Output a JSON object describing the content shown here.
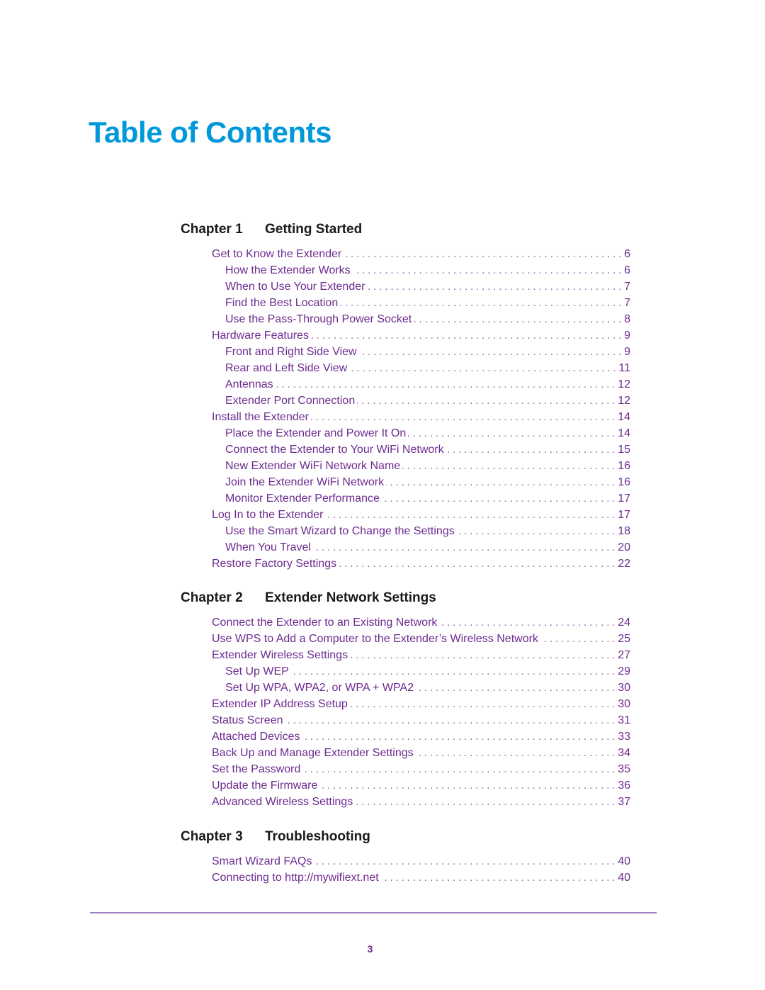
{
  "title": "Table of Contents",
  "colors": {
    "title": "#0098da",
    "entries": "#6d2b8f",
    "rule": "#a07cc3",
    "chapter": "#1a1a1a"
  },
  "chapters": [
    {
      "number": "Chapter 1",
      "name": "Getting Started",
      "entries": [
        {
          "level": 1,
          "label": "Get to Know the Extender",
          "page": "6"
        },
        {
          "level": 2,
          "label": "How the Extender Works",
          "page": "6"
        },
        {
          "level": 2,
          "label": "When to Use Your Extender",
          "page": "7"
        },
        {
          "level": 2,
          "label": "Find the Best Location",
          "page": "7"
        },
        {
          "level": 2,
          "label": "Use the Pass-Through Power Socket",
          "page": "8"
        },
        {
          "level": 1,
          "label": "Hardware Features",
          "page": "9"
        },
        {
          "level": 2,
          "label": "Front and Right Side View",
          "page": "9"
        },
        {
          "level": 2,
          "label": "Rear and Left Side View",
          "page": "11"
        },
        {
          "level": 2,
          "label": "Antennas",
          "page": "12"
        },
        {
          "level": 2,
          "label": "Extender Port Connection",
          "page": "12"
        },
        {
          "level": 1,
          "label": "Install the Extender",
          "page": "14"
        },
        {
          "level": 2,
          "label": "Place the Extender and Power It On",
          "page": "14"
        },
        {
          "level": 2,
          "label": "Connect the Extender to Your WiFi Network",
          "page": "15"
        },
        {
          "level": 2,
          "label": "New Extender WiFi Network Name",
          "page": "16"
        },
        {
          "level": 2,
          "label": "Join the Extender WiFi Network",
          "page": "16"
        },
        {
          "level": 2,
          "label": "Monitor Extender Performance",
          "page": "17"
        },
        {
          "level": 1,
          "label": "Log In to the Extender",
          "page": "17"
        },
        {
          "level": 2,
          "label": "Use the Smart Wizard to Change the Settings",
          "page": "18"
        },
        {
          "level": 2,
          "label": "When You Travel",
          "page": "20"
        },
        {
          "level": 1,
          "label": "Restore Factory Settings",
          "page": "22"
        }
      ]
    },
    {
      "number": "Chapter 2",
      "name": "Extender Network Settings",
      "entries": [
        {
          "level": 1,
          "label": "Connect the Extender to an Existing Network",
          "page": "24"
        },
        {
          "level": 1,
          "label": "Use WPS to Add a Computer to the Extender’s Wireless Network",
          "page": "25"
        },
        {
          "level": 1,
          "label": "Extender Wireless Settings",
          "page": "27"
        },
        {
          "level": 2,
          "label": "Set Up WEP",
          "page": "29"
        },
        {
          "level": 2,
          "label": "Set Up WPA, WPA2, or WPA + WPA2",
          "page": "30"
        },
        {
          "level": 1,
          "label": "Extender IP Address Setup",
          "page": "30"
        },
        {
          "level": 1,
          "label": "Status Screen",
          "page": "31"
        },
        {
          "level": 1,
          "label": "Attached Devices",
          "page": "33"
        },
        {
          "level": 1,
          "label": "Back Up and Manage Extender Settings",
          "page": "34"
        },
        {
          "level": 1,
          "label": "Set the Password",
          "page": "35"
        },
        {
          "level": 1,
          "label": "Update the Firmware",
          "page": "36"
        },
        {
          "level": 1,
          "label": "Advanced Wireless Settings",
          "page": "37"
        }
      ]
    },
    {
      "number": "Chapter 3",
      "name": "Troubleshooting",
      "entries": [
        {
          "level": 1,
          "label": "Smart Wizard FAQs",
          "page": "40"
        },
        {
          "level": 1,
          "label": "Connecting to http://mywifiext.net",
          "page": "40"
        }
      ]
    }
  ],
  "footer": {
    "page_number": "3"
  }
}
